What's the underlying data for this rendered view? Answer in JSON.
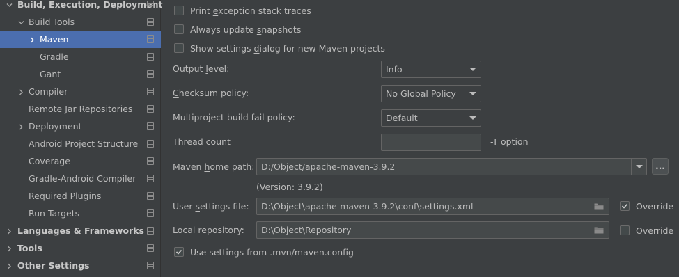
{
  "sidebar": {
    "items": [
      {
        "label": "Build, Execution, Deployment",
        "arrow": "expanded",
        "level": 0,
        "bold": true
      },
      {
        "label": "Build Tools",
        "arrow": "expanded",
        "level": 1,
        "bold": false
      },
      {
        "label": "Maven",
        "arrow": "collapsed",
        "level": 2,
        "bold": false,
        "selected": true
      },
      {
        "label": "Gradle",
        "arrow": "none",
        "level": 2,
        "bold": false
      },
      {
        "label": "Gant",
        "arrow": "none",
        "level": 2,
        "bold": false
      },
      {
        "label": "Compiler",
        "arrow": "collapsed",
        "level": 1,
        "bold": false
      },
      {
        "label": "Remote Jar Repositories",
        "arrow": "none",
        "level": 1,
        "bold": false
      },
      {
        "label": "Deployment",
        "arrow": "collapsed",
        "level": 1,
        "bold": false
      },
      {
        "label": "Android Project Structure",
        "arrow": "none",
        "level": 1,
        "bold": false
      },
      {
        "label": "Coverage",
        "arrow": "none",
        "level": 1,
        "bold": false
      },
      {
        "label": "Gradle-Android Compiler",
        "arrow": "none",
        "level": 1,
        "bold": false
      },
      {
        "label": "Required Plugins",
        "arrow": "none",
        "level": 1,
        "bold": false
      },
      {
        "label": "Run Targets",
        "arrow": "none",
        "level": 1,
        "bold": false
      },
      {
        "label": "Languages & Frameworks",
        "arrow": "collapsed",
        "level": 0,
        "bold": true
      },
      {
        "label": "Tools",
        "arrow": "collapsed",
        "level": 0,
        "bold": true
      },
      {
        "label": "Other Settings",
        "arrow": "collapsed",
        "level": 0,
        "bold": true
      }
    ]
  },
  "maven": {
    "checkboxes": {
      "print_exception": {
        "pre": "Print ",
        "mnemonic": "e",
        "post": "xception stack traces",
        "checked": false
      },
      "always_update": {
        "pre": "Always update ",
        "mnemonic": "s",
        "post": "napshots",
        "checked": false
      },
      "show_dialog": {
        "pre": "Show settings ",
        "mnemonic": "d",
        "post": "ialog for new Maven projects",
        "checked": false
      }
    },
    "output_level": {
      "pre": "Output ",
      "mnemonic": "l",
      "post": "evel:",
      "value": "Info"
    },
    "checksum_policy": {
      "pre": "",
      "mnemonic": "C",
      "post": "hecksum policy:",
      "value": "No Global Policy"
    },
    "multiproject_policy": {
      "pre": "Multiproject build ",
      "mnemonic": "f",
      "post": "ail policy:",
      "value": "Default"
    },
    "thread_count": {
      "label": "Thread count",
      "value": "",
      "hint": "-T option"
    },
    "home_path": {
      "pre": "Maven ",
      "mnemonic": "h",
      "post": "ome path:",
      "value": "D:/Object/apache-maven-3.9.2",
      "browse": "...",
      "version": "(Version: 3.9.2)"
    },
    "user_settings": {
      "pre": "User ",
      "mnemonic": "s",
      "post": "ettings file:",
      "value": "D:\\Object\\apache-maven-3.9.2\\conf\\settings.xml",
      "override_label": "Override",
      "override_checked": true
    },
    "local_repo": {
      "pre": "Local ",
      "mnemonic": "r",
      "post": "epository:",
      "value": "D:\\Object\\Repository",
      "override_label": "Override",
      "override_checked": false
    },
    "use_mvn_config": {
      "label": "Use settings from .mvn/maven.config",
      "checked": true
    }
  },
  "colors": {
    "selection": "#4b6eaf",
    "background": "#3c3f41",
    "text": "#bbbbbb"
  }
}
